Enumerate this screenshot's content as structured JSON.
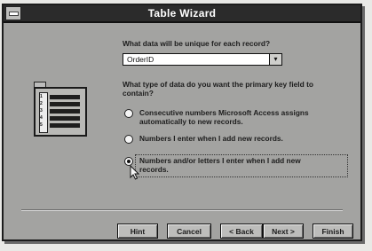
{
  "window": {
    "title": "Table Wizard"
  },
  "question1": "What data will be unique for each record?",
  "unique_field": {
    "value": "OrderID"
  },
  "question2_line1": "What type of data do you want the primary key field to",
  "question2_line2": "contain?",
  "options": [
    {
      "line1": "Consecutive numbers Microsoft Access assigns",
      "line2": "automatically to new records.",
      "checked": false
    },
    {
      "line1": "Numbers I enter when I add new records.",
      "line2": "",
      "checked": false
    },
    {
      "line1": "Numbers and/or letters I enter when I add new",
      "line2": "records.",
      "checked": true
    }
  ],
  "buttons": {
    "hint": "Hint",
    "cancel": "Cancel",
    "back": "< Back",
    "next": "Next >",
    "finish": "Finish"
  },
  "graphic_rows": [
    "1",
    "2",
    "3",
    "4",
    "5"
  ]
}
